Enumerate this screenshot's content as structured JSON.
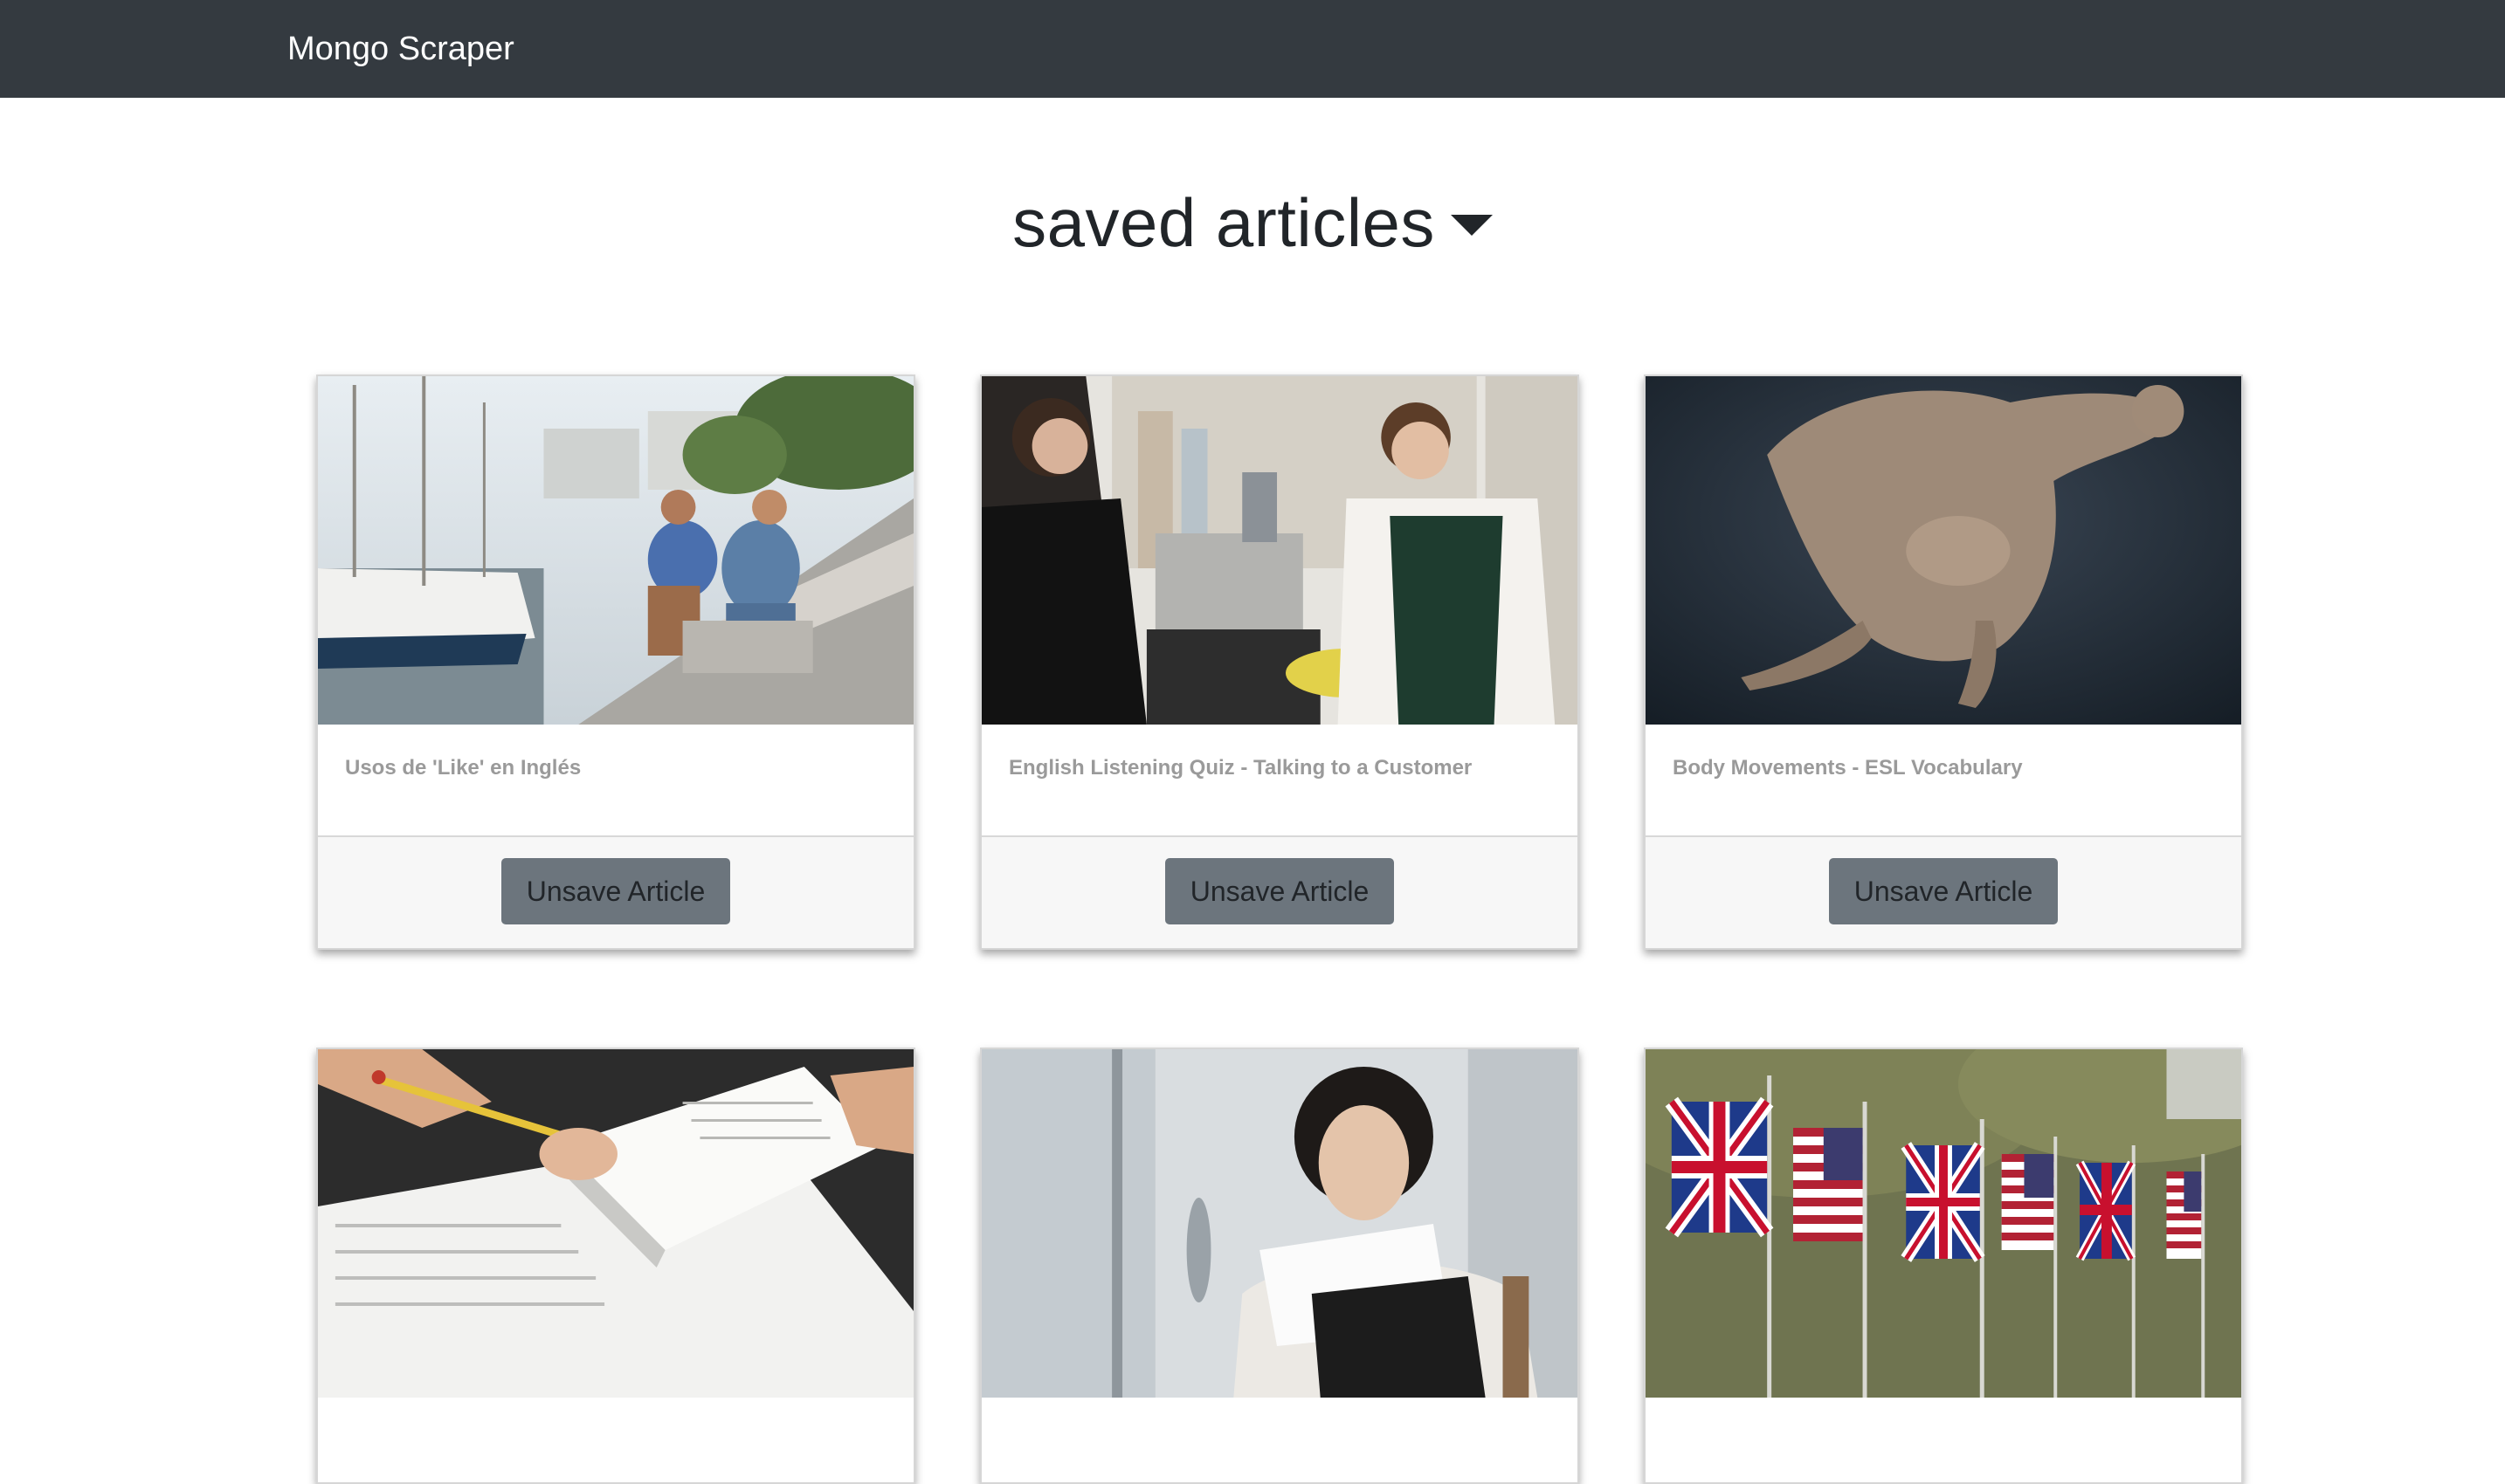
{
  "navbar": {
    "brand": "Mongo Scraper"
  },
  "page": {
    "heading": "saved articles",
    "heading_icon": "caret-down-icon"
  },
  "articles": [
    {
      "title": "Usos de 'Like' en Inglés",
      "button": "Unsave Article",
      "image": "friends-at-harbor-photo"
    },
    {
      "title": "English Listening Quiz - Talking to a Customer",
      "button": "Unsave Article",
      "image": "grocery-checkout-photo"
    },
    {
      "title": "Body Movements - ESL Vocabulary",
      "button": "Unsave Article",
      "image": "crouching-figure-photo"
    },
    {
      "title": "",
      "button": "",
      "image": "study-book-pencil-photo"
    },
    {
      "title": "",
      "button": "",
      "image": "woman-reading-book-photo"
    },
    {
      "title": "",
      "button": "",
      "image": "uk-us-flags-photo"
    }
  ],
  "colors": {
    "navbar_bg": "#343a40",
    "button_bg": "#6c757d",
    "card_footer_bg": "#f7f7f7",
    "title_text": "#9a9a9a"
  }
}
